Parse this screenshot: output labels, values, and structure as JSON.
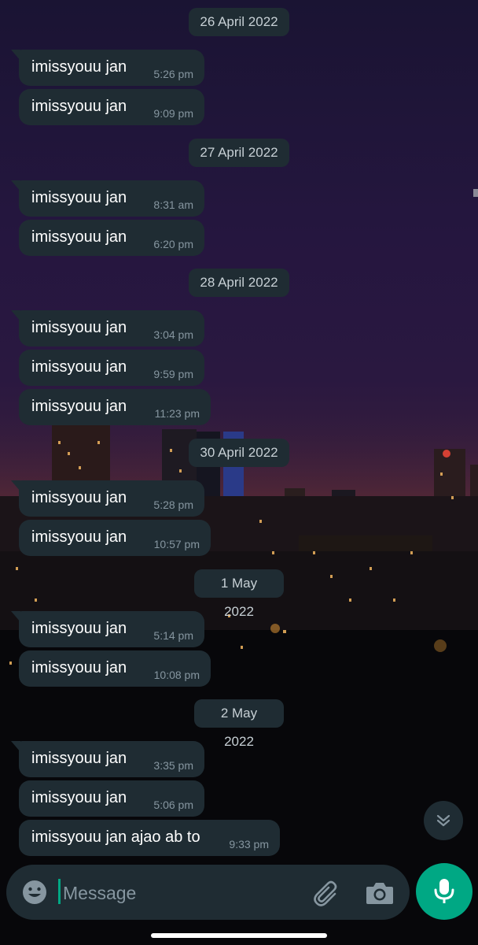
{
  "chat": {
    "groups": [
      {
        "date": "26 April 2022",
        "messages": [
          {
            "text": "imissyouu jan",
            "time": "5:26 pm"
          },
          {
            "text": "imissyouu jan",
            "time": "9:09 pm"
          }
        ]
      },
      {
        "date": "27 April 2022",
        "messages": [
          {
            "text": "imissyouu jan",
            "time": "8:31 am"
          },
          {
            "text": "imissyouu jan",
            "time": "6:20 pm"
          }
        ]
      },
      {
        "date": "28 April 2022",
        "messages": [
          {
            "text": "imissyouu jan",
            "time": "3:04 pm"
          },
          {
            "text": "imissyouu jan",
            "time": "9:59 pm"
          },
          {
            "text": "imissyouu jan",
            "time": "11:23 pm"
          }
        ]
      },
      {
        "date": "30 April 2022",
        "messages": [
          {
            "text": "imissyouu jan",
            "time": "5:28 pm"
          },
          {
            "text": "imissyouu jan",
            "time": "10:57 pm"
          }
        ]
      },
      {
        "date": "1 May 2022",
        "messages": [
          {
            "text": "imissyouu jan",
            "time": "5:14 pm"
          },
          {
            "text": "imissyouu jan",
            "time": "10:08 pm"
          }
        ]
      },
      {
        "date": "2 May 2022",
        "messages": [
          {
            "text": "imissyouu jan",
            "time": "3:35 pm"
          },
          {
            "text": "imissyouu jan",
            "time": "5:06 pm"
          },
          {
            "text": "imissyouu jan ajao ab to",
            "time": "9:33 pm"
          }
        ]
      }
    ]
  },
  "composer": {
    "placeholder": "Message",
    "value": ""
  },
  "icons": {
    "emoji": "emoji-icon",
    "attach": "paperclip-icon",
    "camera": "camera-icon",
    "mic": "microphone-icon",
    "scroll": "chevron-double-down-icon"
  },
  "colors": {
    "bubble": "#1f2c33",
    "accent": "#00a884",
    "timestamp": "#8696a0"
  }
}
